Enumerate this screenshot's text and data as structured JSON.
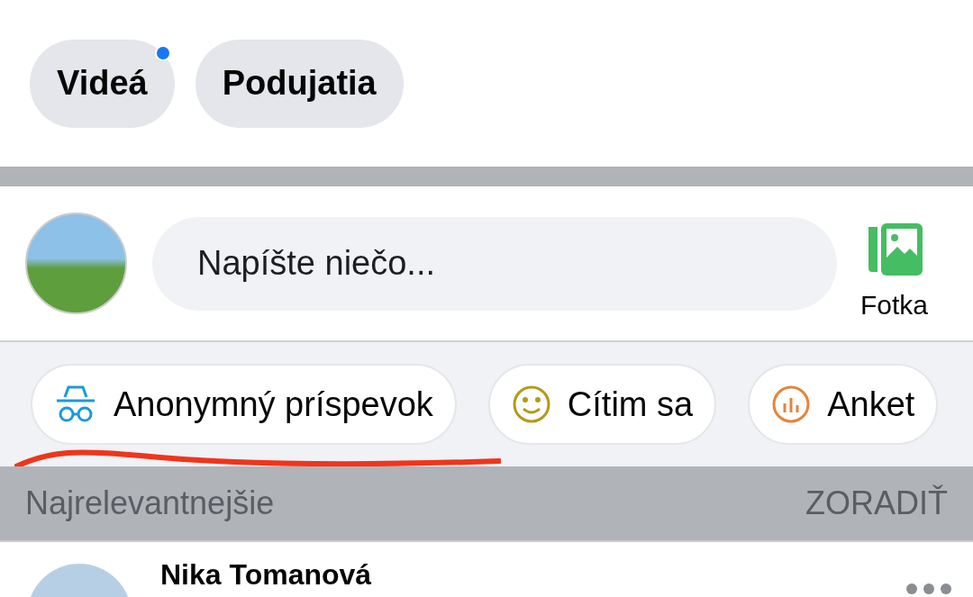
{
  "filter_chips": [
    {
      "label": "Videá",
      "has_notification": true
    },
    {
      "label": "Podujatia",
      "has_notification": false
    }
  ],
  "composer": {
    "placeholder": "Napíšte niečo...",
    "photo_button": "Fotka"
  },
  "post_actions": [
    {
      "kind": "anonymous",
      "label": "Anonymný príspevok"
    },
    {
      "kind": "feeling",
      "label": "Cítim sa"
    },
    {
      "kind": "poll",
      "label": "Anket"
    }
  ],
  "sort_bar": {
    "label": "Najrelevantnejšie",
    "action": "ZORADIŤ"
  },
  "post": {
    "author": "Nika Tomanová"
  }
}
